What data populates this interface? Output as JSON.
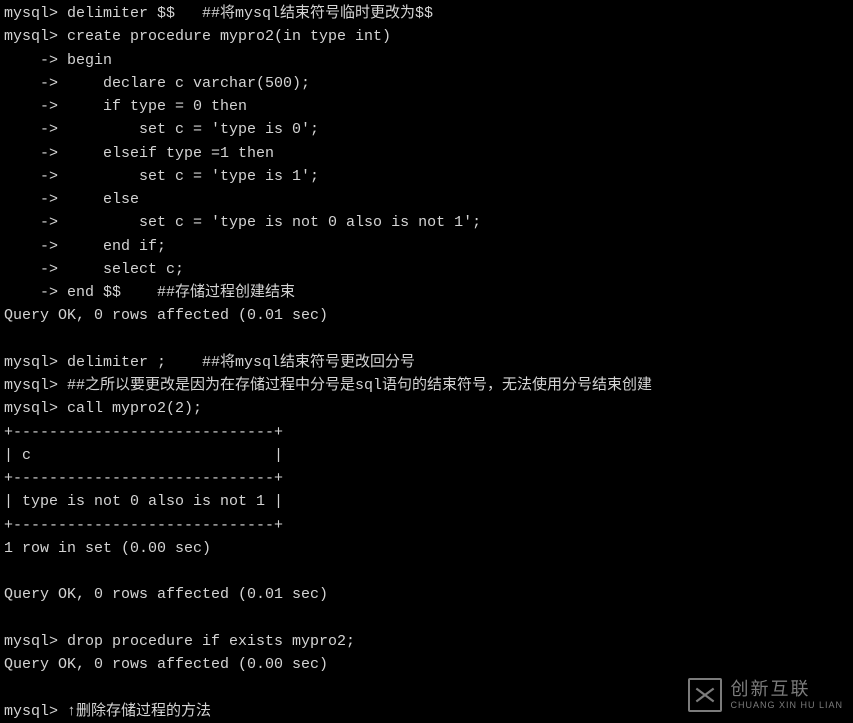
{
  "terminal": {
    "lines": [
      "mysql> delimiter $$   ##将mysql结束符号临时更改为$$",
      "mysql> create procedure mypro2(in type int)",
      "    -> begin",
      "    ->     declare c varchar(500);",
      "    ->     if type = 0 then",
      "    ->         set c = 'type is 0';",
      "    ->     elseif type =1 then",
      "    ->         set c = 'type is 1';",
      "    ->     else",
      "    ->         set c = 'type is not 0 also is not 1';",
      "    ->     end if;",
      "    ->     select c;",
      "    -> end $$    ##存储过程创建结束",
      "Query OK, 0 rows affected (0.01 sec)",
      "",
      "mysql> delimiter ;    ##将mysql结束符号更改回分号",
      "mysql> ##之所以要更改是因为在存储过程中分号是sql语句的结束符号，无法使用分号结束创建",
      "mysql> call mypro2(2);",
      "+-----------------------------+",
      "| c                           |",
      "+-----------------------------+",
      "| type is not 0 also is not 1 |",
      "+-----------------------------+",
      "1 row in set (0.00 sec)",
      "",
      "Query OK, 0 rows affected (0.01 sec)",
      "",
      "mysql> drop procedure if exists mypro2;",
      "Query OK, 0 rows affected (0.00 sec)",
      "",
      "mysql> ↑删除存储过程的方法"
    ]
  },
  "watermark": {
    "name": "创新互联",
    "pinyin": "CHUANG XIN HU LIAN"
  }
}
